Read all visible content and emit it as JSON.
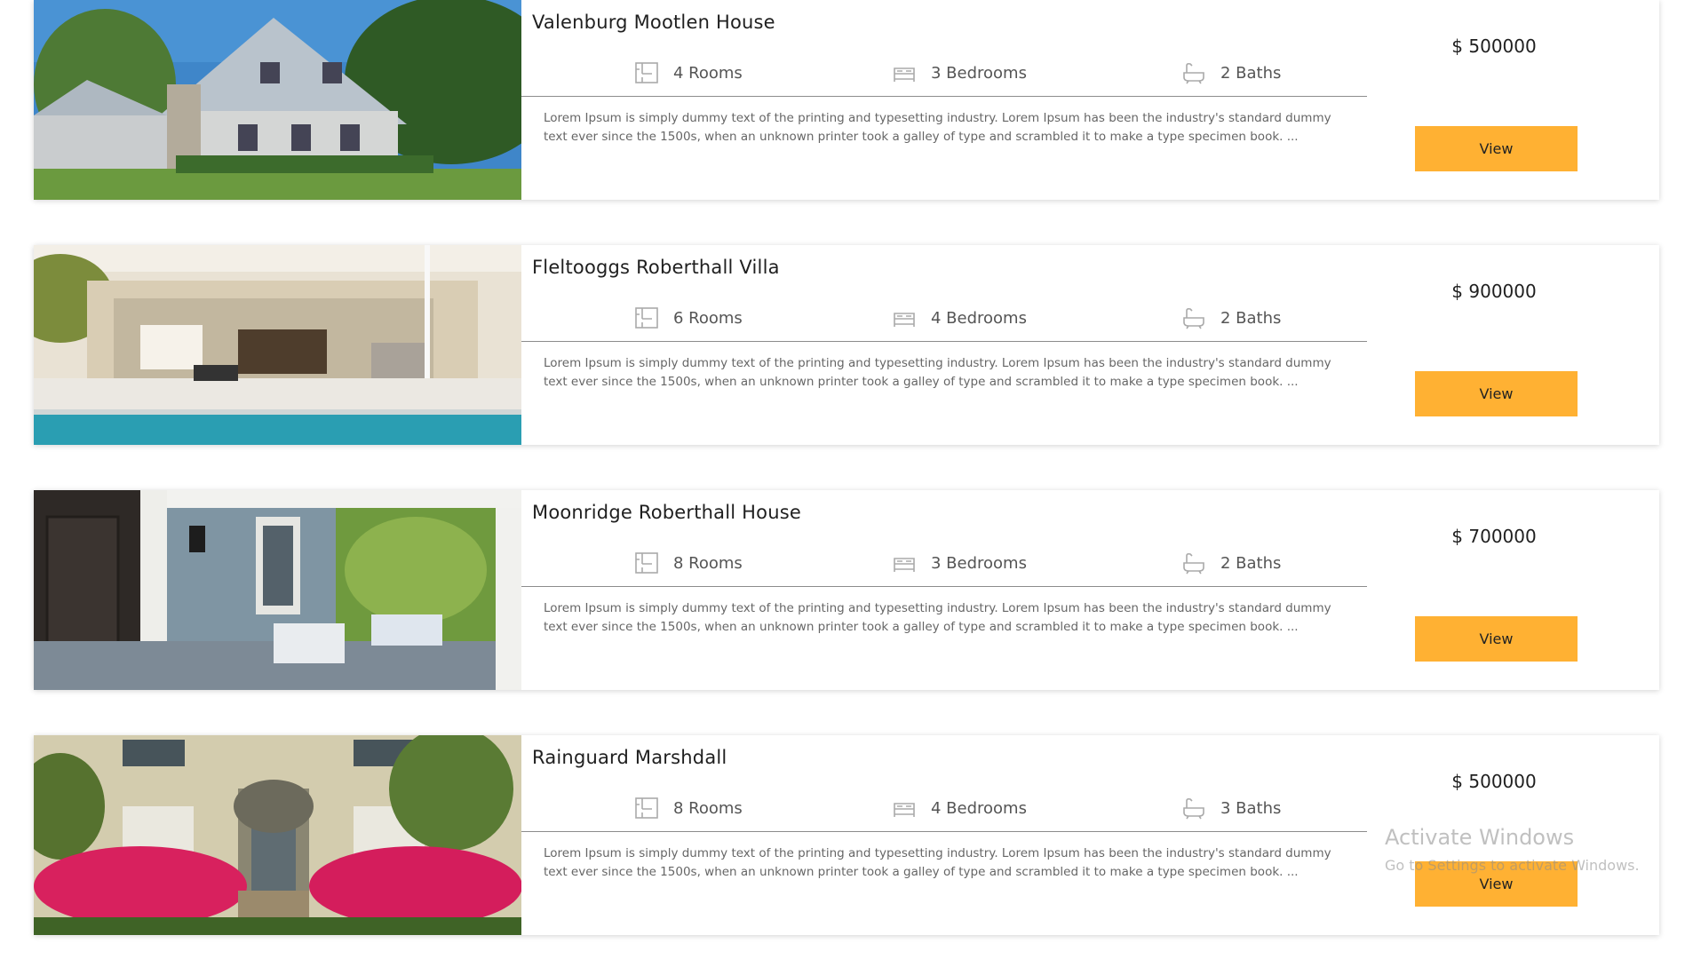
{
  "listings": [
    {
      "title": "Valenburg Mootlen House",
      "rooms": "4 Rooms",
      "bedrooms": "3 Bedrooms",
      "baths": "2 Baths",
      "description": "Lorem Ipsum is simply dummy text of the printing and typesetting industry. Lorem Ipsum has been the industry's standard dummy text ever since the 1500s, when an unknown printer took a galley of type and scrambled it to make a type specimen book. ...",
      "price": "$ 500000",
      "view_label": "View",
      "image": "house-exterior-photo"
    },
    {
      "title": "Fleltooggs Roberthall Villa",
      "rooms": "6 Rooms",
      "bedrooms": "4 Bedrooms",
      "baths": "2 Baths",
      "description": "Lorem Ipsum is simply dummy text of the printing and typesetting industry. Lorem Ipsum has been the industry's standard dummy text ever since the 1500s, when an unknown printer took a galley of type and scrambled it to make a type specimen book. ...",
      "price": "$ 900000",
      "view_label": "View",
      "image": "villa-pool-photo"
    },
    {
      "title": "Moonridge Roberthall House",
      "rooms": "8 Rooms",
      "bedrooms": "3 Bedrooms",
      "baths": "2 Baths",
      "description": "Lorem Ipsum is simply dummy text of the printing and typesetting industry. Lorem Ipsum has been the industry's standard dummy text ever since the 1500s, when an unknown printer took a galley of type and scrambled it to make a type specimen book. ...",
      "price": "$ 700000",
      "view_label": "View",
      "image": "porch-photo"
    },
    {
      "title": "Rainguard Marshdall",
      "rooms": "8 Rooms",
      "bedrooms": "4 Bedrooms",
      "baths": "3 Baths",
      "description": "Lorem Ipsum is simply dummy text of the printing and typesetting industry. Lorem Ipsum has been the industry's standard dummy text ever since the 1500s, when an unknown printer took a galley of type and scrambled it to make a type specimen book. ...",
      "price": "$ 500000",
      "view_label": "View",
      "image": "flowers-house-photo"
    }
  ],
  "icons": {
    "rooms": "floorplan-icon",
    "bedrooms": "bed-icon",
    "baths": "bathtub-icon"
  },
  "colors": {
    "accent": "#ffb133",
    "divider": "#8c8c8c"
  },
  "watermark": {
    "line1": "Activate Windows",
    "line2": "Go to Settings to activate Windows."
  }
}
